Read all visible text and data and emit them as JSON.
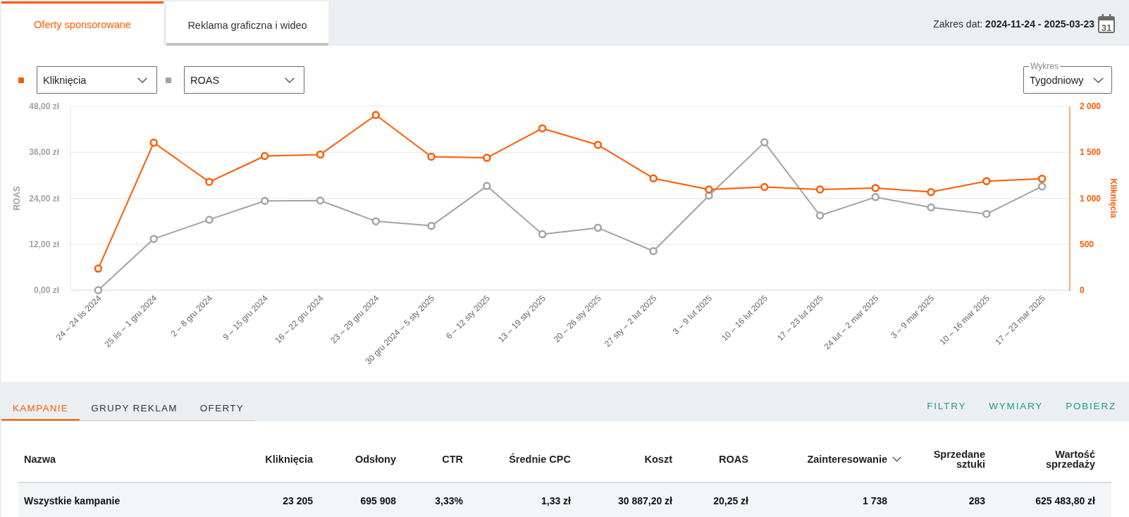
{
  "tabs": [
    {
      "label": "Oferty sponsorowane",
      "selected": true
    },
    {
      "label": "Reklama graficzna i wideo",
      "selected": false
    }
  ],
  "date_range": {
    "text": "Zakres dat: **2024-11-24 - 2025-03-23**",
    "calendar_day": "31"
  },
  "chart": {
    "period": {
      "label": "Wykres",
      "value": "Tygodniowy"
    },
    "chart_data": {
      "type": "line",
      "grid": true,
      "ylabel": "ROAS",
      "y2label": "Kliknięcia",
      "categories": [
        "24 – 24 lis 2024",
        "25 lis – 1 gru 2024",
        "2 – 8 gru 2024",
        "9 – 15 gru 2024",
        "16 – 22 gru 2024",
        "23 – 29 gru 2024",
        "30 gru 2024 – 5 sty 2025",
        "6 – 12 sty 2025",
        "13 – 19 sty 2025",
        "20 – 26 sty 2025",
        "27 sty – 2 lut 2025",
        "3 – 9 lut 2025",
        "10 – 16 lut 2025",
        "17 – 23 lut 2025",
        "24 lut – 2 mar 2025",
        "3 – 9 mar 2025",
        "10 – 16 mar 2025",
        "17 – 23 mar 2025"
      ],
      "series": [
        {
          "name": "Kliknięcia",
          "color": "#ff5a00",
          "axis": "y2",
          "marker": "circle",
          "values": [
            235,
            1605,
            1178,
            1460,
            1476,
            1906,
            1452,
            1440,
            1761,
            1581,
            1217,
            1096,
            1123,
            1096,
            1112,
            1068,
            1186,
            1213
          ]
        },
        {
          "name": "ROAS",
          "color": "#a3a3a3",
          "marker": "circle",
          "values": [
            0,
            13.4,
            18.4,
            23.3,
            23.4,
            18.0,
            16.8,
            27.2,
            14.6,
            16.3,
            10.2,
            24.7,
            38.6,
            19.5,
            24.3,
            21.6,
            19.9,
            27.1
          ]
        }
      ],
      "ylim": [
        0,
        48
      ],
      "yticks": [
        {
          "value": 0,
          "label": "0,00 zł"
        },
        {
          "value": 12,
          "label": "12,00 zł"
        },
        {
          "value": 24,
          "label": "24,00 zł"
        },
        {
          "value": 36,
          "label": "36,00 zł"
        },
        {
          "value": 48,
          "label": "48,00 zł"
        }
      ],
      "y2lim": [
        0,
        2000
      ],
      "y2ticks": [
        {
          "value": 0,
          "label": "0"
        },
        {
          "value": 500,
          "label": "500"
        },
        {
          "value": 1000,
          "label": "1 000"
        },
        {
          "value": 1500,
          "label": "1 500"
        },
        {
          "value": 2000,
          "label": "2 000"
        }
      ]
    }
  },
  "table_tabs": [
    {
      "label": "KAMPANIE",
      "selected": true
    },
    {
      "label": "GRUPY REKLAM",
      "selected": false
    },
    {
      "label": "OFERTY",
      "selected": false
    }
  ],
  "actions": [
    "FILTRY",
    "WYMIARY",
    "POBIERZ"
  ],
  "table": {
    "columns": [
      {
        "label": "Nazwa",
        "sorted": false
      },
      {
        "label": "Kliknięcia",
        "sorted": false
      },
      {
        "label": "Odsłony",
        "sorted": false
      },
      {
        "label": "CTR",
        "sorted": false
      },
      {
        "label": "Średnie CPC",
        "sorted": false
      },
      {
        "label": "Koszt",
        "sorted": false
      },
      {
        "label": "ROAS",
        "sorted": false
      },
      {
        "label": "Zainteresowanie",
        "sorted": true
      },
      {
        "label": "Sprzedane sztuki",
        "sorted": false
      },
      {
        "label": "Wartość sprzedaży",
        "sorted": false
      }
    ],
    "rows": [
      {
        "cells": [
          "Wszystkie kampanie",
          "23 205",
          "695 908",
          "3,33%",
          "1,33 zł",
          "30 887,20 zł",
          "20,25 zł",
          "1 738",
          "283",
          "625 483,80 zł"
        ]
      }
    ]
  }
}
